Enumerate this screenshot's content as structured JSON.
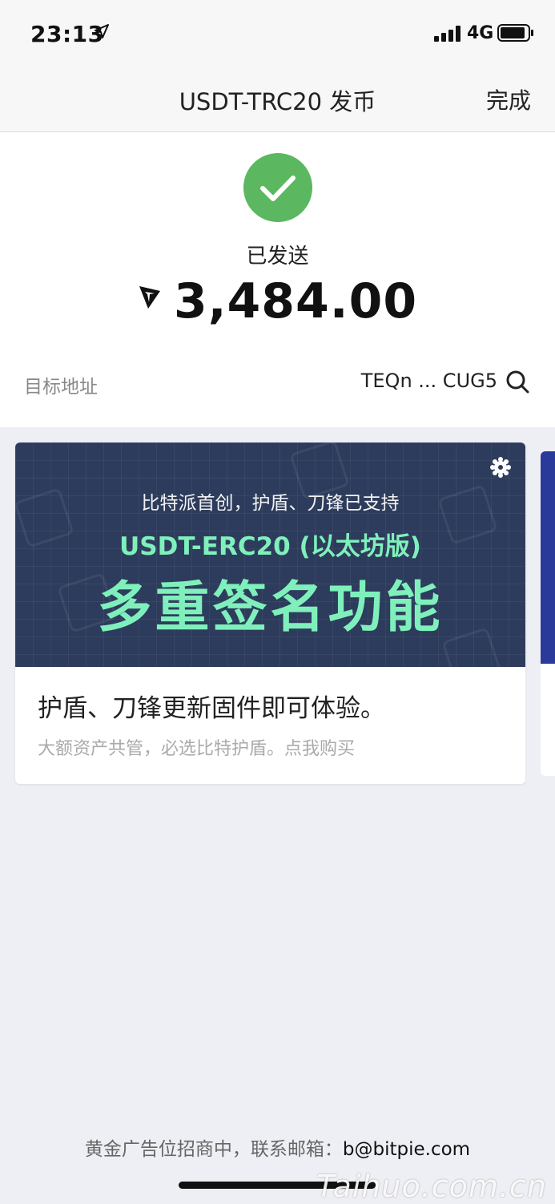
{
  "status_bar": {
    "time": "23:13",
    "network": "4G"
  },
  "nav": {
    "title": "USDT-TRC20 发币",
    "done_label": "完成"
  },
  "summary": {
    "status": "已发送",
    "amount": "3,484.00",
    "address_label": "目标地址",
    "address_value": "TEQn ... CUG5"
  },
  "banner": {
    "line1": "比特派首创，护盾、刀锋已支持",
    "line2": "USDT-ERC20 (以太坊版)",
    "line3": "多重签名功能",
    "title": "护盾、刀锋更新固件即可体验。",
    "subtitle": "大额资产共管，必选比特护盾。点我购买"
  },
  "footer": {
    "text": "黄金广告位招商中，联系邮箱：",
    "email": "b@bitpie.com"
  },
  "watermark": "Taihuo.com.cn",
  "colors": {
    "success": "#5cb860",
    "banner_bg": "#2d3c5c",
    "banner_accent": "#7ff0bb"
  }
}
